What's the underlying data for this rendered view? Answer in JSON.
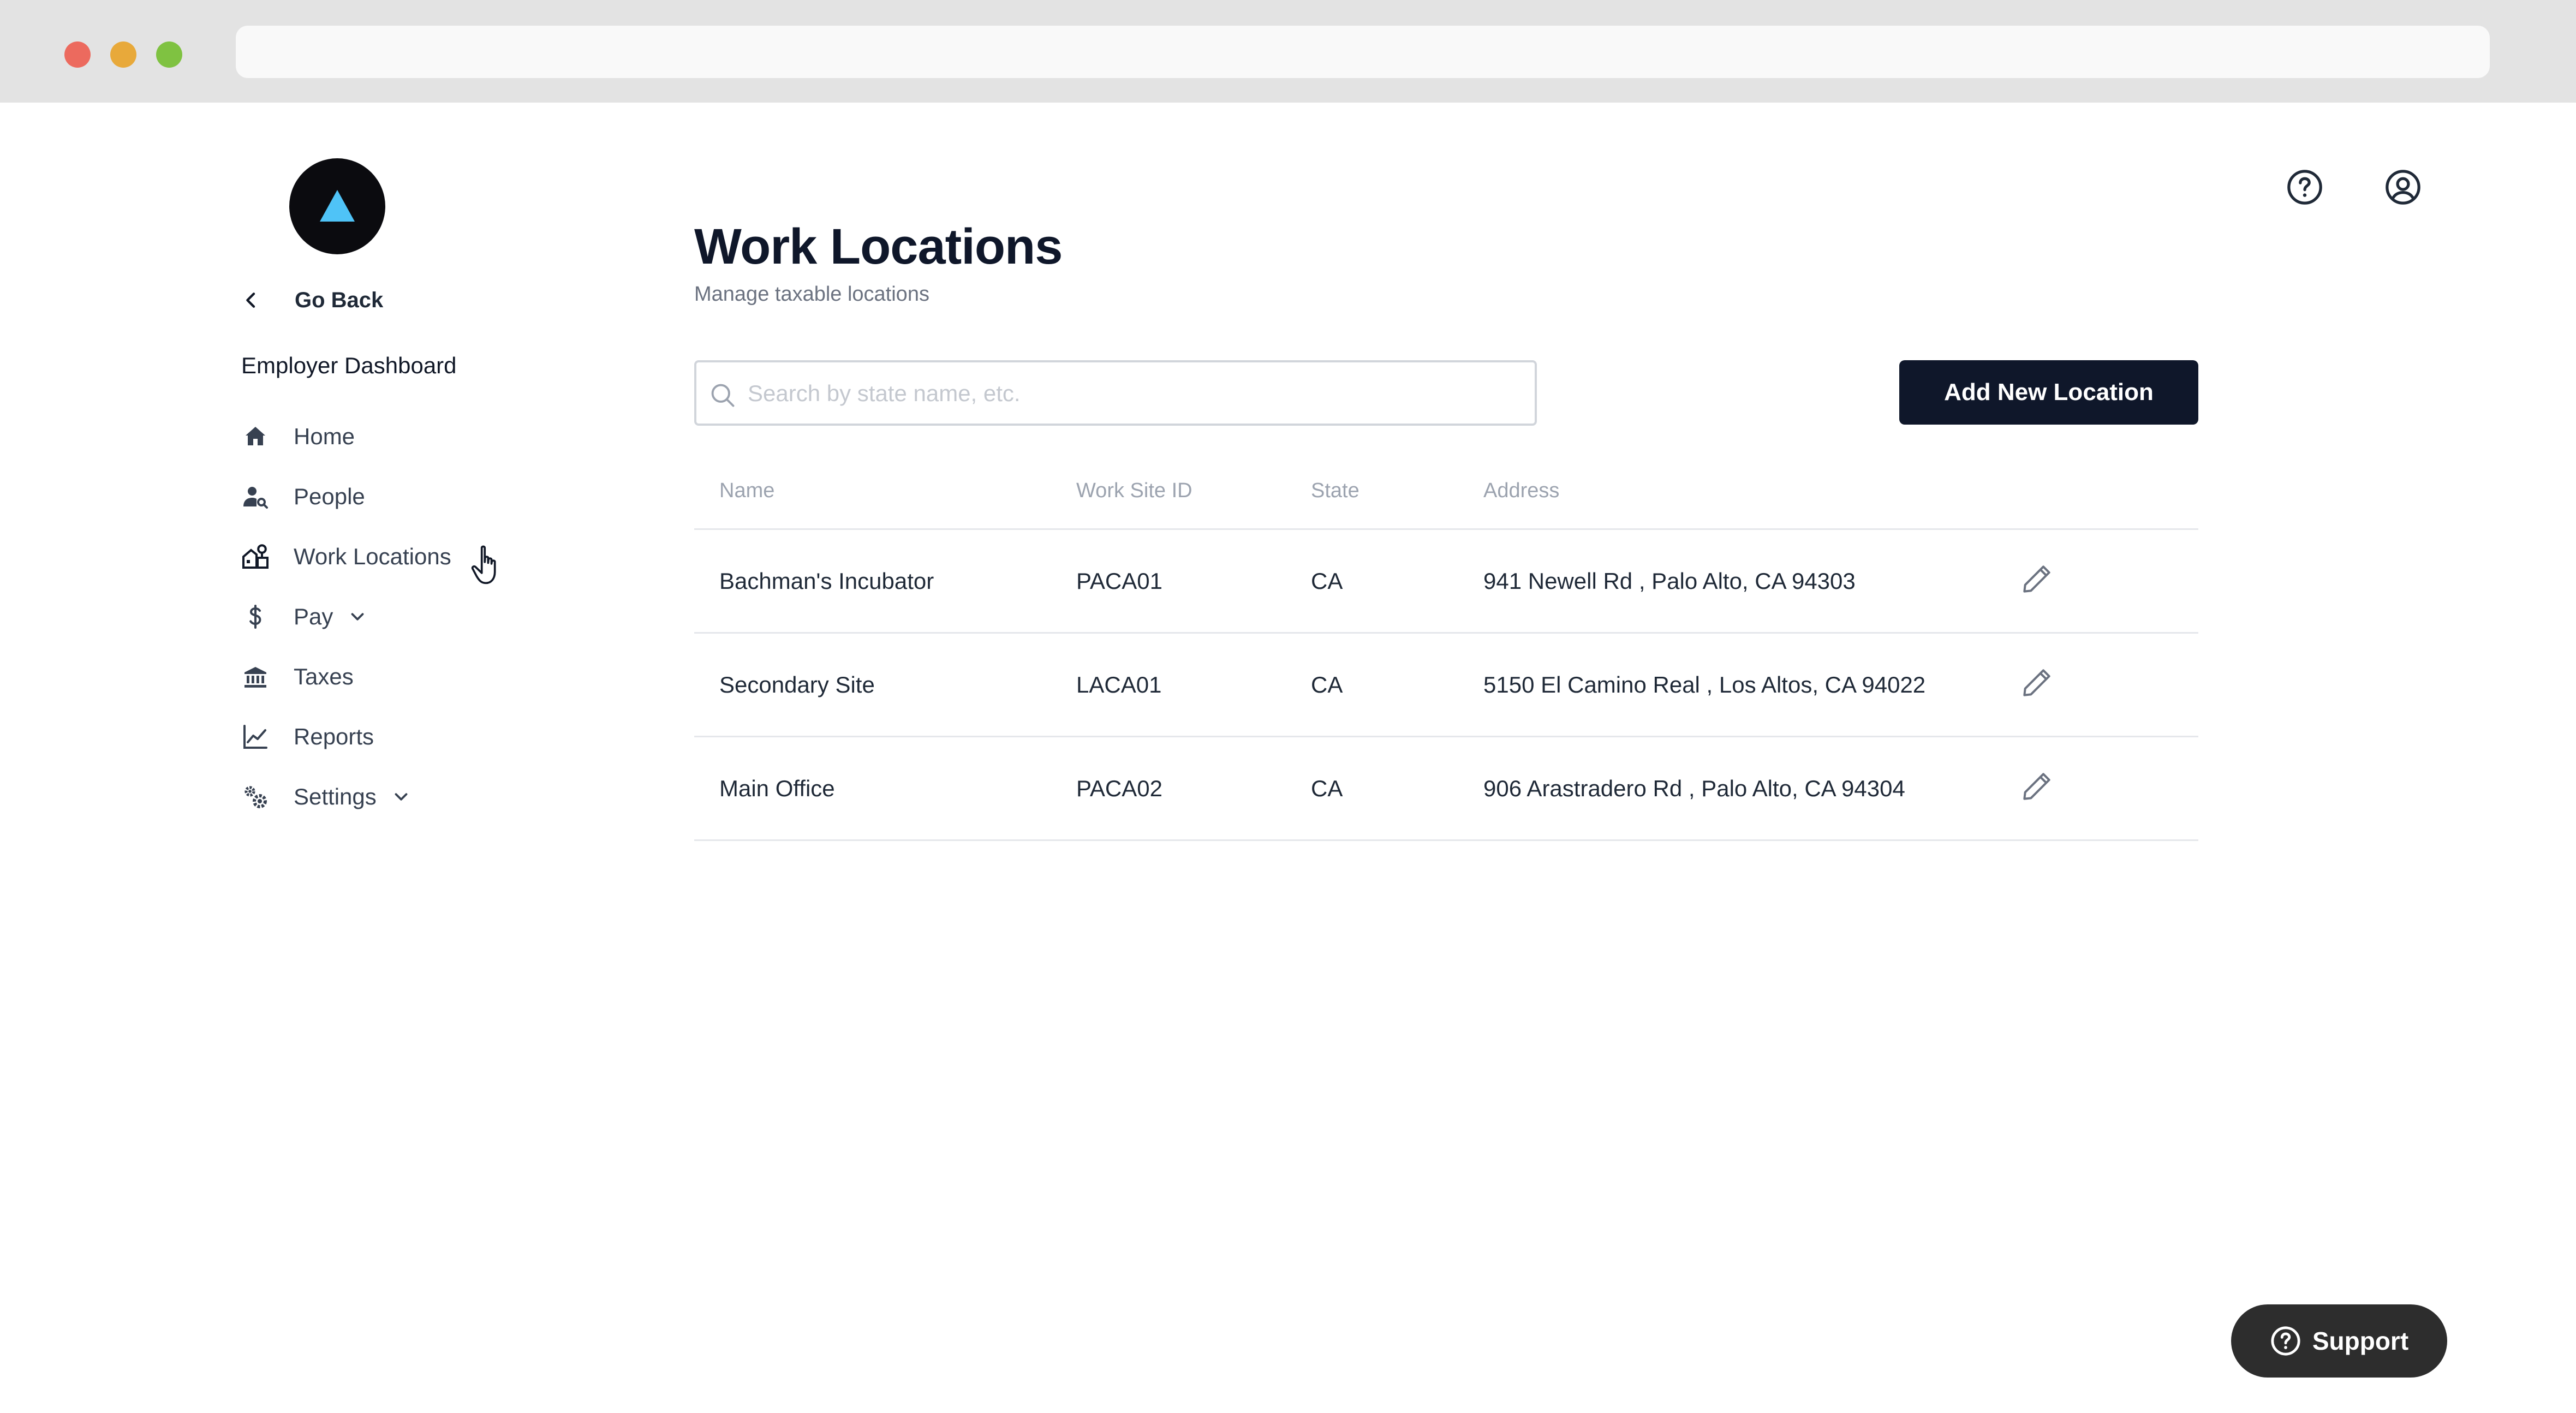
{
  "sidebar": {
    "go_back": "Go Back",
    "section_title": "Employer Dashboard",
    "items": [
      {
        "label": "Home",
        "icon": "home-icon"
      },
      {
        "label": "People",
        "icon": "people-search-icon"
      },
      {
        "label": "Work Locations",
        "icon": "work-locations-icon"
      },
      {
        "label": "Pay",
        "icon": "dollar-icon",
        "has_caret": true
      },
      {
        "label": "Taxes",
        "icon": "bank-icon"
      },
      {
        "label": "Reports",
        "icon": "chart-line-icon"
      },
      {
        "label": "Settings",
        "icon": "gears-icon",
        "has_caret": true
      }
    ]
  },
  "header": {
    "title": "Work Locations",
    "subtitle": "Manage taxable locations"
  },
  "search": {
    "placeholder": "Search by state name, etc.",
    "value": ""
  },
  "actions": {
    "add_label": "Add New Location"
  },
  "table": {
    "columns": [
      "Name",
      "Work Site ID",
      "State",
      "Address"
    ],
    "rows": [
      {
        "name": "Bachman's Incubator",
        "site_id": "PACA01",
        "state": "CA",
        "address": "941 Newell Rd , Palo Alto, CA 94303"
      },
      {
        "name": "Secondary Site",
        "site_id": "LACA01",
        "state": "CA",
        "address": "5150 El Camino Real , Los Altos, CA 94022"
      },
      {
        "name": "Main Office",
        "site_id": "PACA02",
        "state": "CA",
        "address": "906 Arastradero Rd , Palo Alto, CA 94304"
      }
    ]
  },
  "support": {
    "label": "Support"
  },
  "colors": {
    "primary_button": "#0f172a",
    "logo_bg": "#0b0b0f",
    "logo_accent": "#4fc3f7",
    "support_bg": "#2d2d2d"
  }
}
